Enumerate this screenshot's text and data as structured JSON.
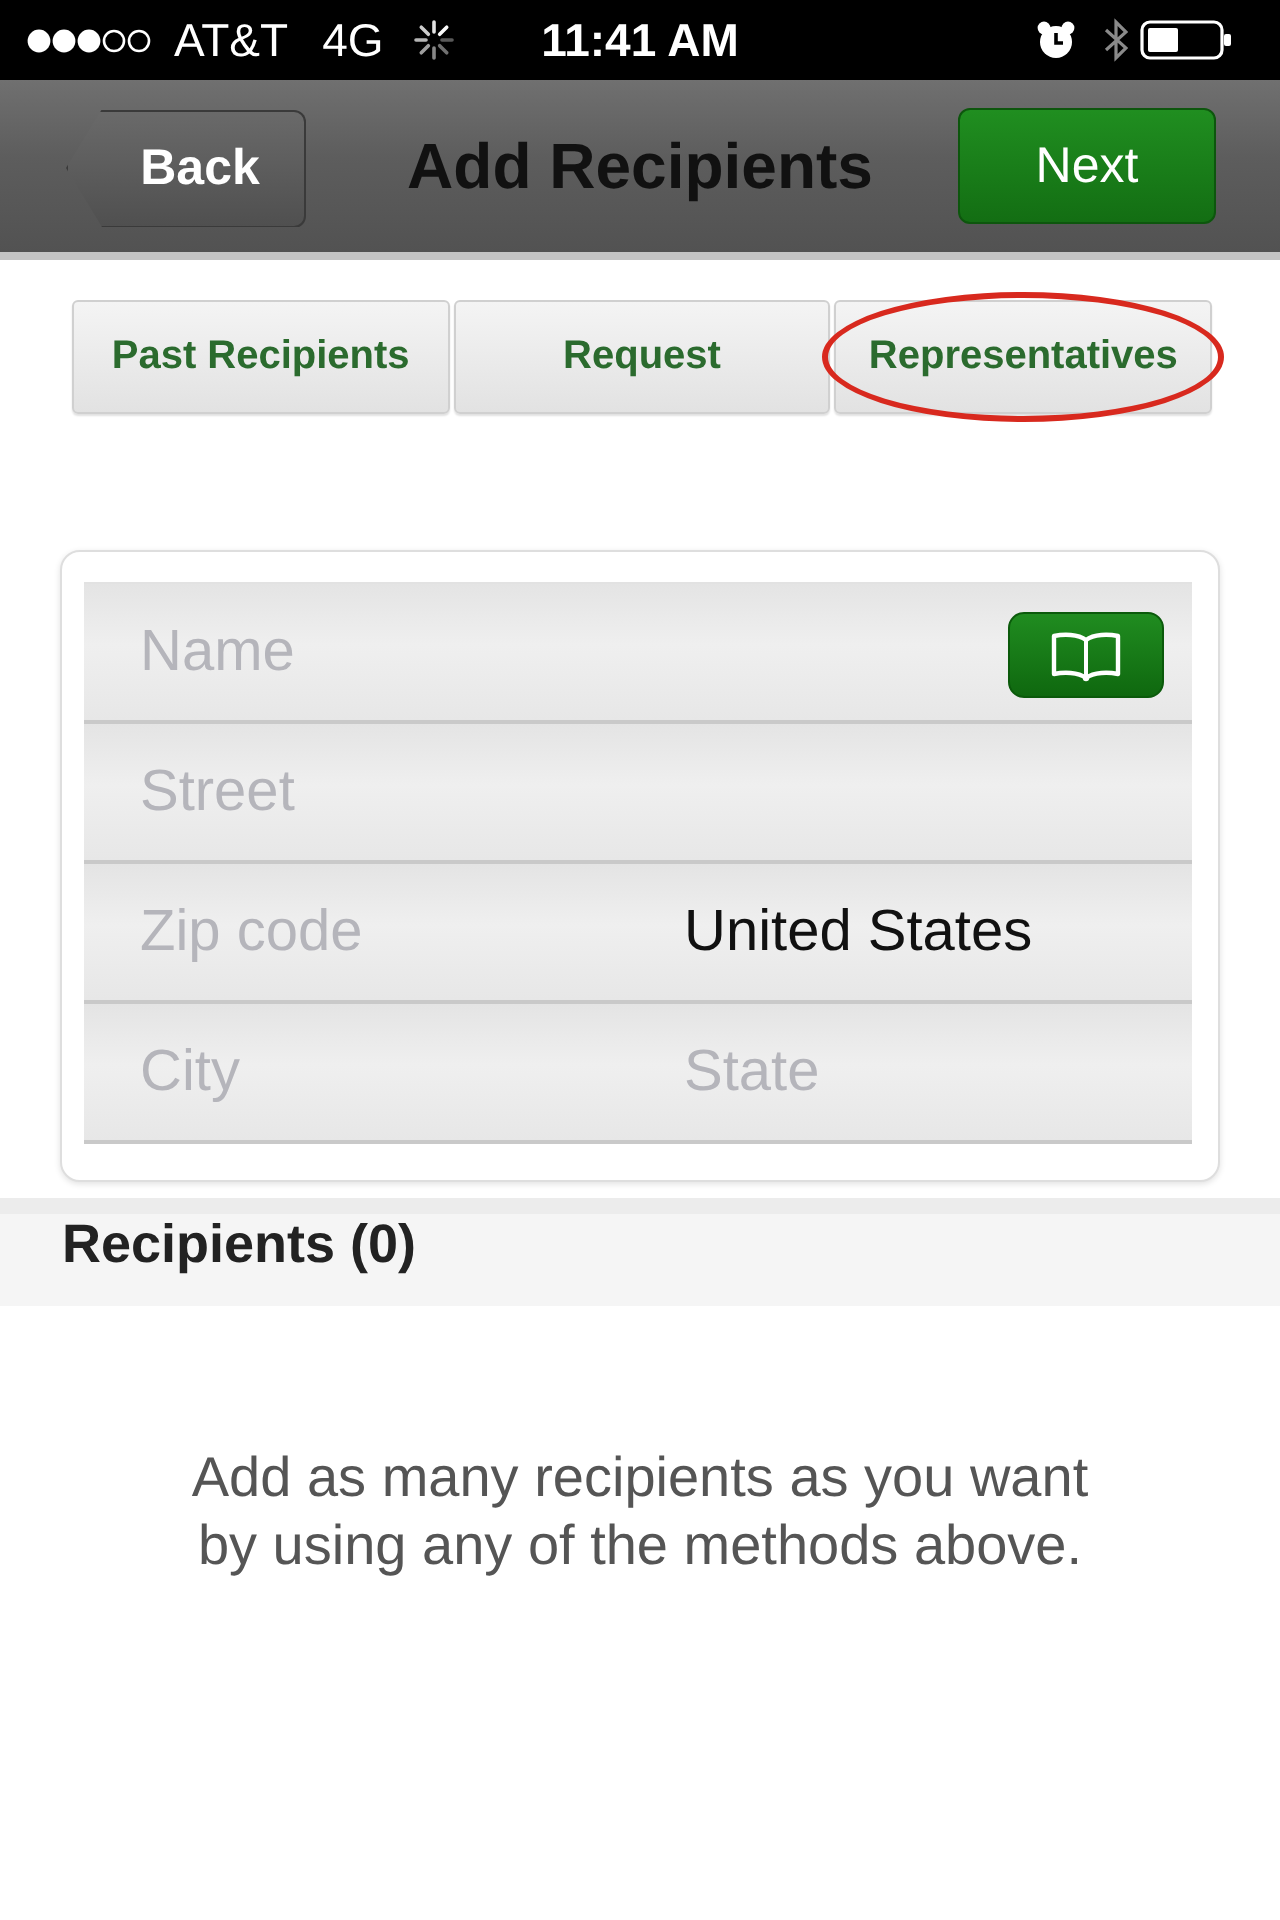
{
  "status_bar": {
    "carrier": "AT&T",
    "network": "4G",
    "time": "11:41 AM"
  },
  "nav_bar": {
    "back_button": "Back",
    "title": "Add Recipients",
    "next_button": "Next"
  },
  "methods": [
    {
      "label": "Past Recipients",
      "circled": false
    },
    {
      "label": "Request",
      "circled": false
    },
    {
      "label": "Representatives",
      "circled": true
    }
  ],
  "address_form": {
    "rows": [
      {
        "fields": [
          {
            "kind": "lookup",
            "placeholder": "Name"
          }
        ]
      },
      {
        "fields": [
          {
            "kind": "text",
            "placeholder": "Street"
          }
        ]
      },
      {
        "fields": [
          {
            "kind": "text",
            "placeholder": "Zip code"
          },
          {
            "kind": "text",
            "value": "United States"
          }
        ]
      },
      {
        "fields": [
          {
            "kind": "text",
            "placeholder": "City"
          },
          {
            "kind": "text",
            "placeholder": "State"
          }
        ]
      }
    ]
  },
  "recipients": {
    "title": "Recipients (0)",
    "empty_message": "Add as many recipients as you want by using any of the methods above."
  }
}
